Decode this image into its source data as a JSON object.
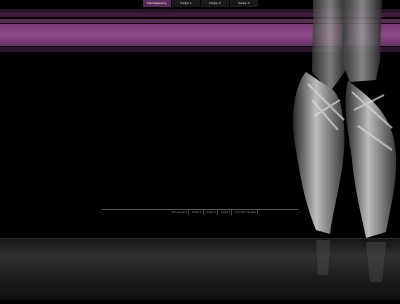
{
  "nav": {
    "tabs": [
      {
        "label": "Напоминать",
        "active": true
      },
      {
        "label": "Кафе 1",
        "active": false
      },
      {
        "label": "Кафе 2",
        "active": false
      },
      {
        "label": "Кафе 3",
        "active": false
      }
    ]
  },
  "footer": {
    "links": [
      "Напоминать",
      "Кафе 1",
      "Кафе 2",
      "Кафе 3",
      "Контакт-формы"
    ]
  },
  "colors": {
    "accent": "#7a3a78",
    "background": "#000000"
  }
}
